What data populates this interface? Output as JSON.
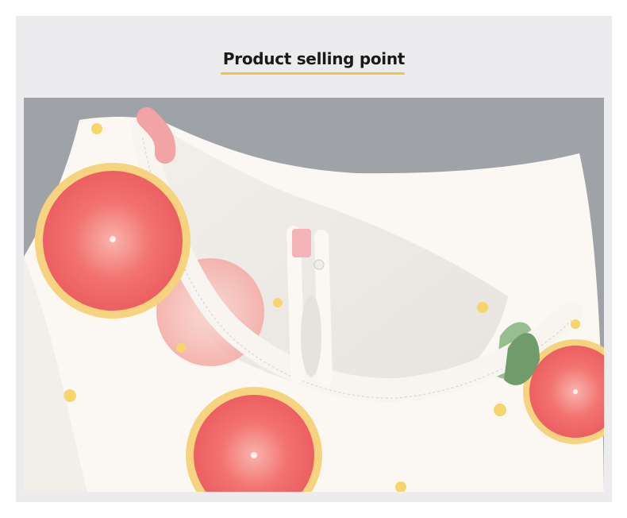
{
  "header": {
    "title": "Product selling point",
    "accent_color": "#f3c24a"
  },
  "photo": {
    "subject": "garment-neckline-closeup",
    "colors": {
      "background": "#9ea1a6",
      "fabric": "#fbf8f3",
      "grapefruit": "#f06a6a",
      "rind": "#f4d37a",
      "dots": "#f6d66a",
      "leaf": "#7fae78"
    }
  }
}
